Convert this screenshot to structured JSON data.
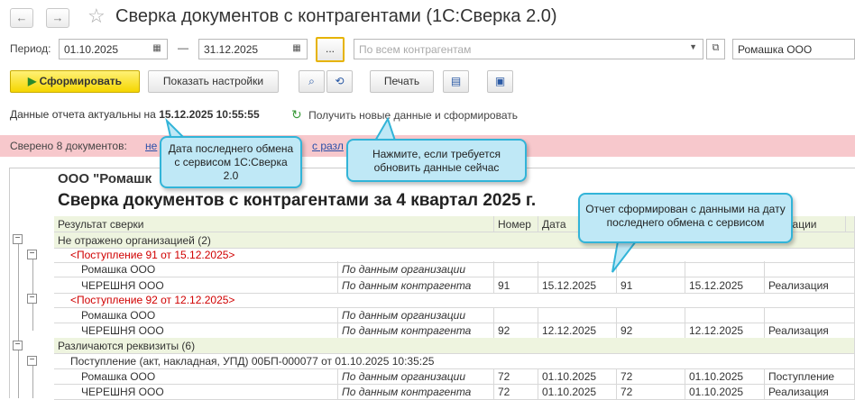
{
  "window": {
    "title": "Сверка документов с контрагентами (1С:Сверка 2.0)"
  },
  "period": {
    "label": "Период:",
    "from": "01.10.2025",
    "dash": "—",
    "to": "31.12.2025",
    "more": "..."
  },
  "counterparty_filter": {
    "placeholder": "По всем контрагентам"
  },
  "organization": {
    "value": "Ромашка ООО"
  },
  "toolbar": {
    "generate": "Сформировать",
    "show_settings": "Показать настройки",
    "print": "Печать"
  },
  "status": {
    "actual_label": "Данные отчета актуальны на",
    "actual_datetime": "15.12.2025 10:55:55",
    "refresh_link": "Получить новые данные и сформировать"
  },
  "banner": {
    "text": "Сверено 8 документов: ",
    "link1": "не",
    "link2": "с разл"
  },
  "report": {
    "org_header": "ООО \"Ромашк",
    "title": "Сверка документов с контрагентами за 4 квартал 2025 г.",
    "columns": [
      "Результат сверки",
      "Номер",
      "Дата",
      "",
      "",
      "операции"
    ],
    "rows": [
      {
        "type": "group",
        "text": "Не отражено организацией (2)"
      },
      {
        "type": "doc",
        "text": "<Поступление 91 от 15.12.2025>"
      },
      {
        "type": "line",
        "name": "Ромашка ООО",
        "src": "По данным организации",
        "num": "",
        "date": "",
        "num2": "",
        "date2": "",
        "op": ""
      },
      {
        "type": "line",
        "name": "ЧЕРЕШНЯ ООО",
        "src": "По данным контрагента",
        "num": "91",
        "date": "15.12.2025",
        "num2": "91",
        "date2": "15.12.2025",
        "op": "Реализация"
      },
      {
        "type": "doc",
        "text": "<Поступление 92 от 12.12.2025>"
      },
      {
        "type": "line",
        "name": "Ромашка ООО",
        "src": "По данным организации",
        "num": "",
        "date": "",
        "num2": "",
        "date2": "",
        "op": ""
      },
      {
        "type": "line",
        "name": "ЧЕРЕШНЯ ООО",
        "src": "По данным контрагента",
        "num": "92",
        "date": "12.12.2025",
        "num2": "92",
        "date2": "12.12.2025",
        "op": "Реализация"
      },
      {
        "type": "group",
        "text": "Различаются реквизиты (6)"
      },
      {
        "type": "doc2",
        "text": "Поступление (акт, накладная, УПД) 00БП-000077 от 01.10.2025 10:35:25"
      },
      {
        "type": "line",
        "name": "Ромашка ООО",
        "src": "По данным организации",
        "num": "72",
        "date": "01.10.2025",
        "num2": "72",
        "date2": "01.10.2025",
        "op": "Поступление"
      },
      {
        "type": "line",
        "name": "ЧЕРЕШНЯ ООО",
        "src": "По данным контрагента",
        "num": "72",
        "date": "01.10.2025",
        "num2": "72",
        "date2": "01.10.2025",
        "op": "Реализация"
      }
    ]
  },
  "callouts": {
    "last_exchange": "Дата последнего обмена с сервисом 1С:Сверка 2.0",
    "refresh_hint": "Нажмите, если требуется обновить данные сейчас",
    "report_note": "Отчет сформирован с данными на дату последнего обмена с сервисом"
  },
  "colors": {
    "accent": "#f5d600",
    "banner": "#f7c8cc",
    "callout_border": "#32b4d8",
    "callout_bg": "#bfe8f6",
    "group_bg": "#eef4df",
    "red_text": "#d00000"
  }
}
